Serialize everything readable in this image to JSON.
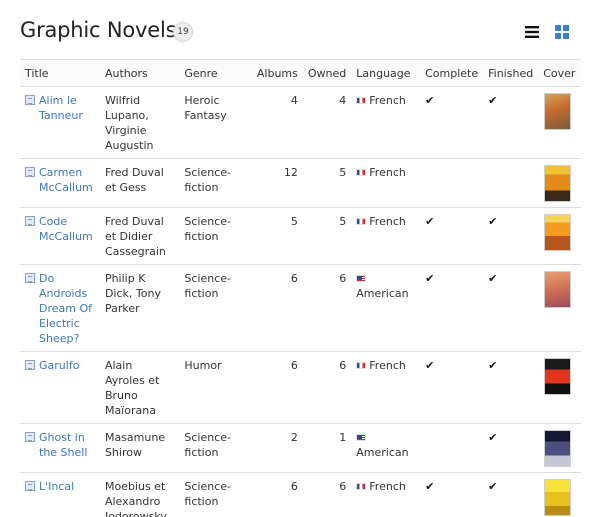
{
  "header": {
    "title": "Graphic Novels",
    "count": "19"
  },
  "columns": {
    "title": "Title",
    "authors": "Authors",
    "genre": "Genre",
    "albums": "Albums",
    "owned": "Owned",
    "language": "Language",
    "complete": "Complete",
    "finished": "Finished",
    "cover": "Cover"
  },
  "check_glyph": "✔",
  "rows": [
    {
      "title": "Alim le Tanneur",
      "authors": "Wilfrid Lupano, Virginie Augustin",
      "genre": "Heroic Fantasy",
      "albums": "4",
      "owned": "4",
      "language": "French",
      "flag": "fr",
      "complete": true,
      "finished": true
    },
    {
      "title": "Carmen McCallum",
      "authors": "Fred Duval et Gess",
      "genre": "Science-fiction",
      "albums": "12",
      "owned": "5",
      "language": "French",
      "flag": "fr",
      "complete": false,
      "finished": false
    },
    {
      "title": "Code McCallum",
      "authors": "Fred Duval et Didier Cassegrain",
      "genre": "Science-fiction",
      "albums": "5",
      "owned": "5",
      "language": "French",
      "flag": "fr",
      "complete": true,
      "finished": true
    },
    {
      "title": "Do Androids Dream Of Electric Sheep?",
      "authors": "Philip K Dick, Tony Parker",
      "genre": "Science-fiction",
      "albums": "6",
      "owned": "6",
      "language": "American",
      "flag": "us",
      "complete": true,
      "finished": true
    },
    {
      "title": "Garulfo",
      "authors": "Alain Ayroles et Bruno Maïorana",
      "genre": "Humor",
      "albums": "6",
      "owned": "6",
      "language": "French",
      "flag": "fr",
      "complete": true,
      "finished": true
    },
    {
      "title": "Ghost in the Shell",
      "authors": "Masamune Shirow",
      "genre": "Science-fiction",
      "albums": "2",
      "owned": "1",
      "language": "American",
      "flag": "us",
      "complete": false,
      "finished": true
    },
    {
      "title": "L'Incal",
      "authors": "Moebius et Alexandro Jodorowsky",
      "genre": "Science-fiction",
      "albums": "6",
      "owned": "6",
      "language": "French",
      "flag": "fr",
      "complete": true,
      "finished": true
    }
  ]
}
